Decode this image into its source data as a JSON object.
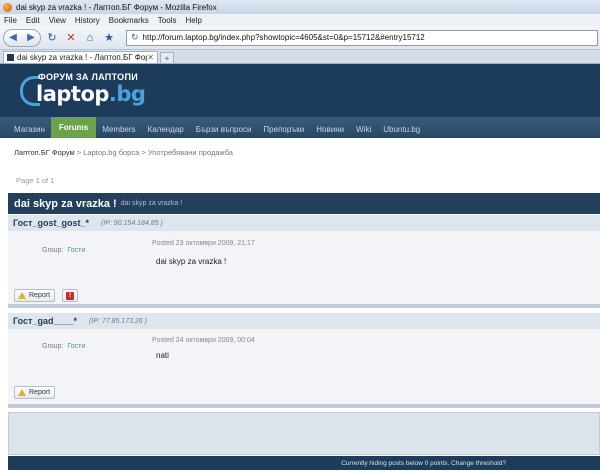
{
  "window": {
    "title": "dai skyp za vrazka ! - Лаптоп.БГ Форум - Mozilla Firefox"
  },
  "menubar": {
    "items": [
      "File",
      "Edit",
      "View",
      "History",
      "Bookmarks",
      "Tools",
      "Help"
    ]
  },
  "navbar": {
    "url": "http://forum.laptop.bg/index.php?showtopic=4605&st=0&p=15712&#entry15712"
  },
  "tabs": [
    {
      "label": "dai skyp za vrazka ! - Лаптоп.БГ Форум"
    }
  ],
  "site": {
    "tagline": "ФОРУМ ЗА ЛАПТОПИ",
    "logo_main": "laptop",
    "logo_tld": ".bg",
    "menu": [
      "Магазин",
      "Forums",
      "Members",
      "Календар",
      "Бързи въпроси",
      "Препоръки",
      "Новини",
      "Wiki",
      "Ubuntu.bg"
    ],
    "active_menu": "Forums"
  },
  "breadcrumb": {
    "root": "Лаптоп.БГ Форум",
    "level1": "Laptop.bg борса",
    "level2": "Употребявани продажба",
    "sep": ">"
  },
  "page_info": "Page 1 of 1",
  "topic": {
    "title": "dai skyp za vrazka !",
    "subtitle": "dai skyp za vrazka !"
  },
  "posts": [
    {
      "author": "Гост_gost_gost_*",
      "ip": "(IP: 90.154.184.85 )",
      "group_label": "Group:",
      "group_value": "Гости",
      "date": "Posted 23 октомври 2009, 21:17",
      "content": "dai skyp za vrazka !",
      "report_label": "Report"
    },
    {
      "author": "Гост_gad____*",
      "ip": "(IP: 77.85.173.26 )",
      "group_label": "Group:",
      "group_value": "Гости",
      "date": "Posted 24 октомври 2009, 00:04",
      "content": "nati",
      "report_label": "Report"
    }
  ],
  "footer": {
    "text": "Currently hiding posts below 0 points. Change threshold?"
  },
  "colors": {
    "header_bg": "#1d3c5c",
    "active_menu": "#6ba24a",
    "logo_accent": "#4aa3df"
  }
}
